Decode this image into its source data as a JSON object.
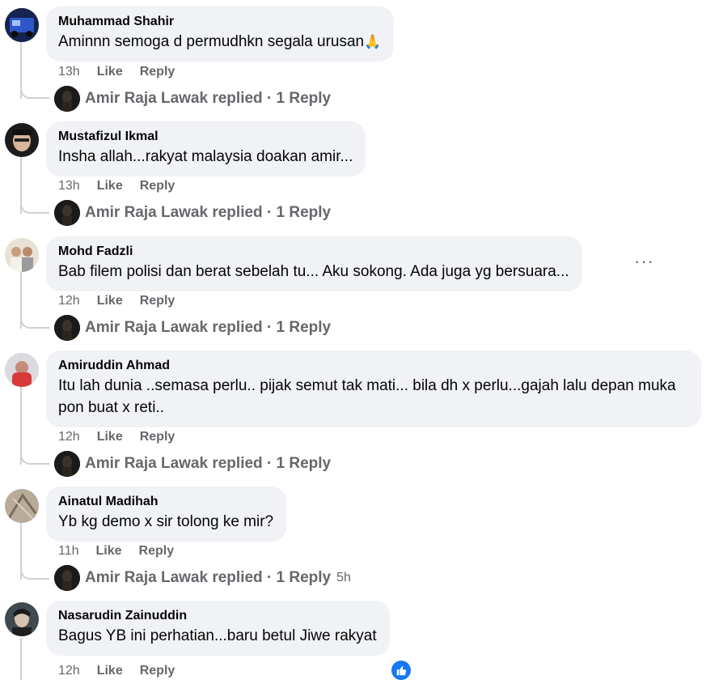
{
  "comments": [
    {
      "author": "Muhammad Shahir",
      "text": "Aminnn semoga d permudhkn segala urusan",
      "emoji": "🙏",
      "time": "13h",
      "like": "Like",
      "reply": "Reply",
      "replied": "Amir Raja Lawak replied · 1 Reply",
      "replied_time": ""
    },
    {
      "author": "Mustafizul Ikmal",
      "text": "Insha allah...rakyat malaysia doakan amir...",
      "time": "13h",
      "like": "Like",
      "reply": "Reply",
      "replied": "Amir Raja Lawak replied · 1 Reply",
      "replied_time": ""
    },
    {
      "author": "Mohd Fadzli",
      "text": "Bab filem polisi dan berat sebelah tu... Aku sokong. Ada juga yg bersuara...",
      "time": "12h",
      "like": "Like",
      "reply": "Reply",
      "replied": "Amir Raja Lawak replied · 1 Reply",
      "replied_time": ""
    },
    {
      "author": "Amiruddin Ahmad",
      "text": "Itu lah dunia ..semasa perlu.. pijak semut tak mati... bila dh x perlu...gajah lalu depan muka pon buat x reti..",
      "time": "12h",
      "like": "Like",
      "reply": "Reply",
      "replied": "Amir Raja Lawak replied · 1 Reply",
      "replied_time": ""
    },
    {
      "author": "Ainatul Madihah",
      "text": "Yb kg demo x sir tolong ke mir?",
      "time": "11h",
      "like": "Like",
      "reply": "Reply",
      "replied": "Amir Raja Lawak replied · 1 Reply",
      "replied_time": "5h"
    },
    {
      "author": "Nasarudin Zainuddin",
      "text": "Bagus YB ini perhatian...baru betul Jiwe rakyat",
      "time": "12h",
      "like": "Like",
      "reply": "Reply"
    }
  ],
  "more_options": "···",
  "icons": {
    "more": "more-options-icon",
    "like_reaction": "thumbs-up-icon",
    "emoji": "praying-hands-icon"
  },
  "colors": {
    "bubble": "#f0f2f5",
    "secondary_text": "#65676b",
    "thread_line": "#ced0d4",
    "like_blue": "#1877f2"
  }
}
